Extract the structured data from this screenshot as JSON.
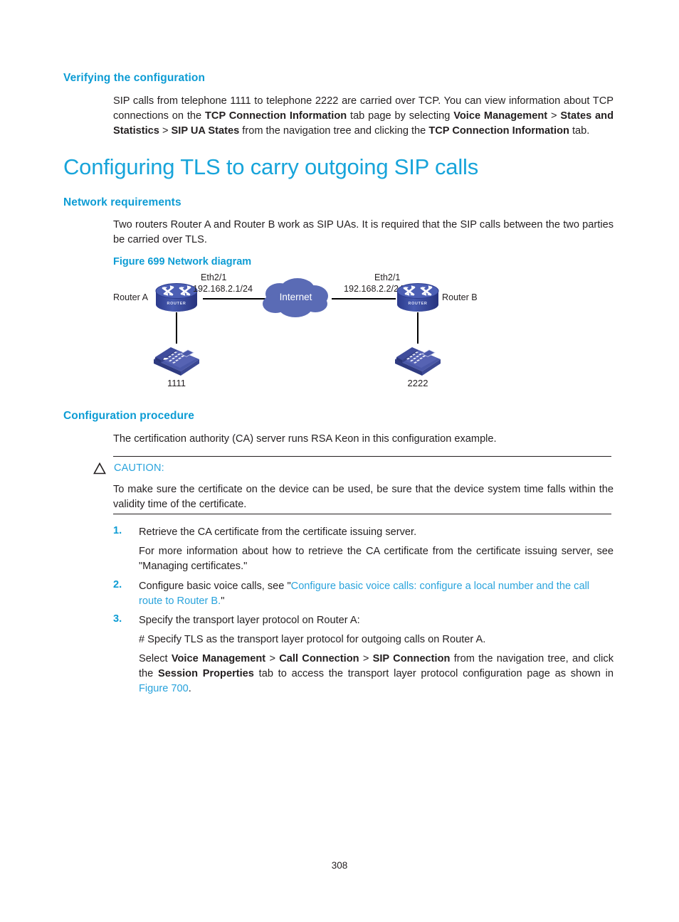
{
  "document": {
    "page_number": "308"
  },
  "sections": {
    "verifying": {
      "heading": "Verifying the configuration",
      "paragraph_plain": "SIP calls from telephone 1111 to telephone 2222 are carried over TCP. You can view information about TCP connections on the TCP Connection Information tab page by selecting Voice Management > States and Statistics > SIP UA States from the navigation tree and clicking the TCP Connection Information tab."
    },
    "main_title": "Configuring TLS to carry outgoing SIP calls",
    "network_requirements": {
      "heading": "Network requirements",
      "paragraph": "Two routers Router A and Router B work as SIP UAs. It is required that the SIP calls between the two parties be carried over TLS."
    },
    "figure": {
      "caption": "Figure 699 Network diagram"
    },
    "configuration_procedure": {
      "heading": "Configuration procedure",
      "intro": "The certification authority (CA) server runs RSA Keon in this configuration example.",
      "caution": {
        "label": "CAUTION:",
        "text": "To make sure the certificate on the device can be used, be sure that the device system time falls within the validity time of the certificate."
      },
      "steps": [
        {
          "number": "1.",
          "text": "Retrieve the CA certificate from the certificate issuing server.",
          "sub": "For more information about how to retrieve the CA certificate from the certificate issuing server, see \"Managing certificates.\""
        },
        {
          "number": "2.",
          "lead": "Configure basic voice calls, see \"",
          "link": "Configure basic voice calls: configure a local number and the call route to Router B.",
          "tail": "\""
        },
        {
          "number": "3.",
          "text": "Specify the transport layer protocol on Router A:",
          "comment": "# Specify TLS as the transport layer protocol for outgoing calls on Router A.",
          "select_lead": "Select ",
          "nav1": "Voice Management",
          "sep1": " > ",
          "nav2": "Call Connection",
          "sep2": " > ",
          "nav3": "SIP Connection",
          "select_mid": " from the navigation tree, and click the ",
          "tab_name": "Session Properties",
          "select_tail": " tab to access the transport layer protocol configuration page as shown in ",
          "figure_link": "Figure 700",
          "period": "."
        }
      ]
    }
  },
  "diagram": {
    "router_a_label": "Router A",
    "router_b_label": "Router B",
    "router_badge": "ROUTER",
    "cloud_label": "Internet",
    "left_iface_name": "Eth2/1",
    "left_iface_ip": "192.168.2.1/24",
    "right_iface_name": "Eth2/1",
    "right_iface_ip": "192.168.2.2/24",
    "phone_a_number": "1111",
    "phone_b_number": "2222"
  },
  "colors": {
    "heading_cyan": "#0d9cd4",
    "title_cyan": "#17a4da",
    "link_blue": "#29a3dc",
    "body_black": "#231f20",
    "device_blue": "#3b4a9e",
    "cloud_blue": "#5a6bb5"
  }
}
